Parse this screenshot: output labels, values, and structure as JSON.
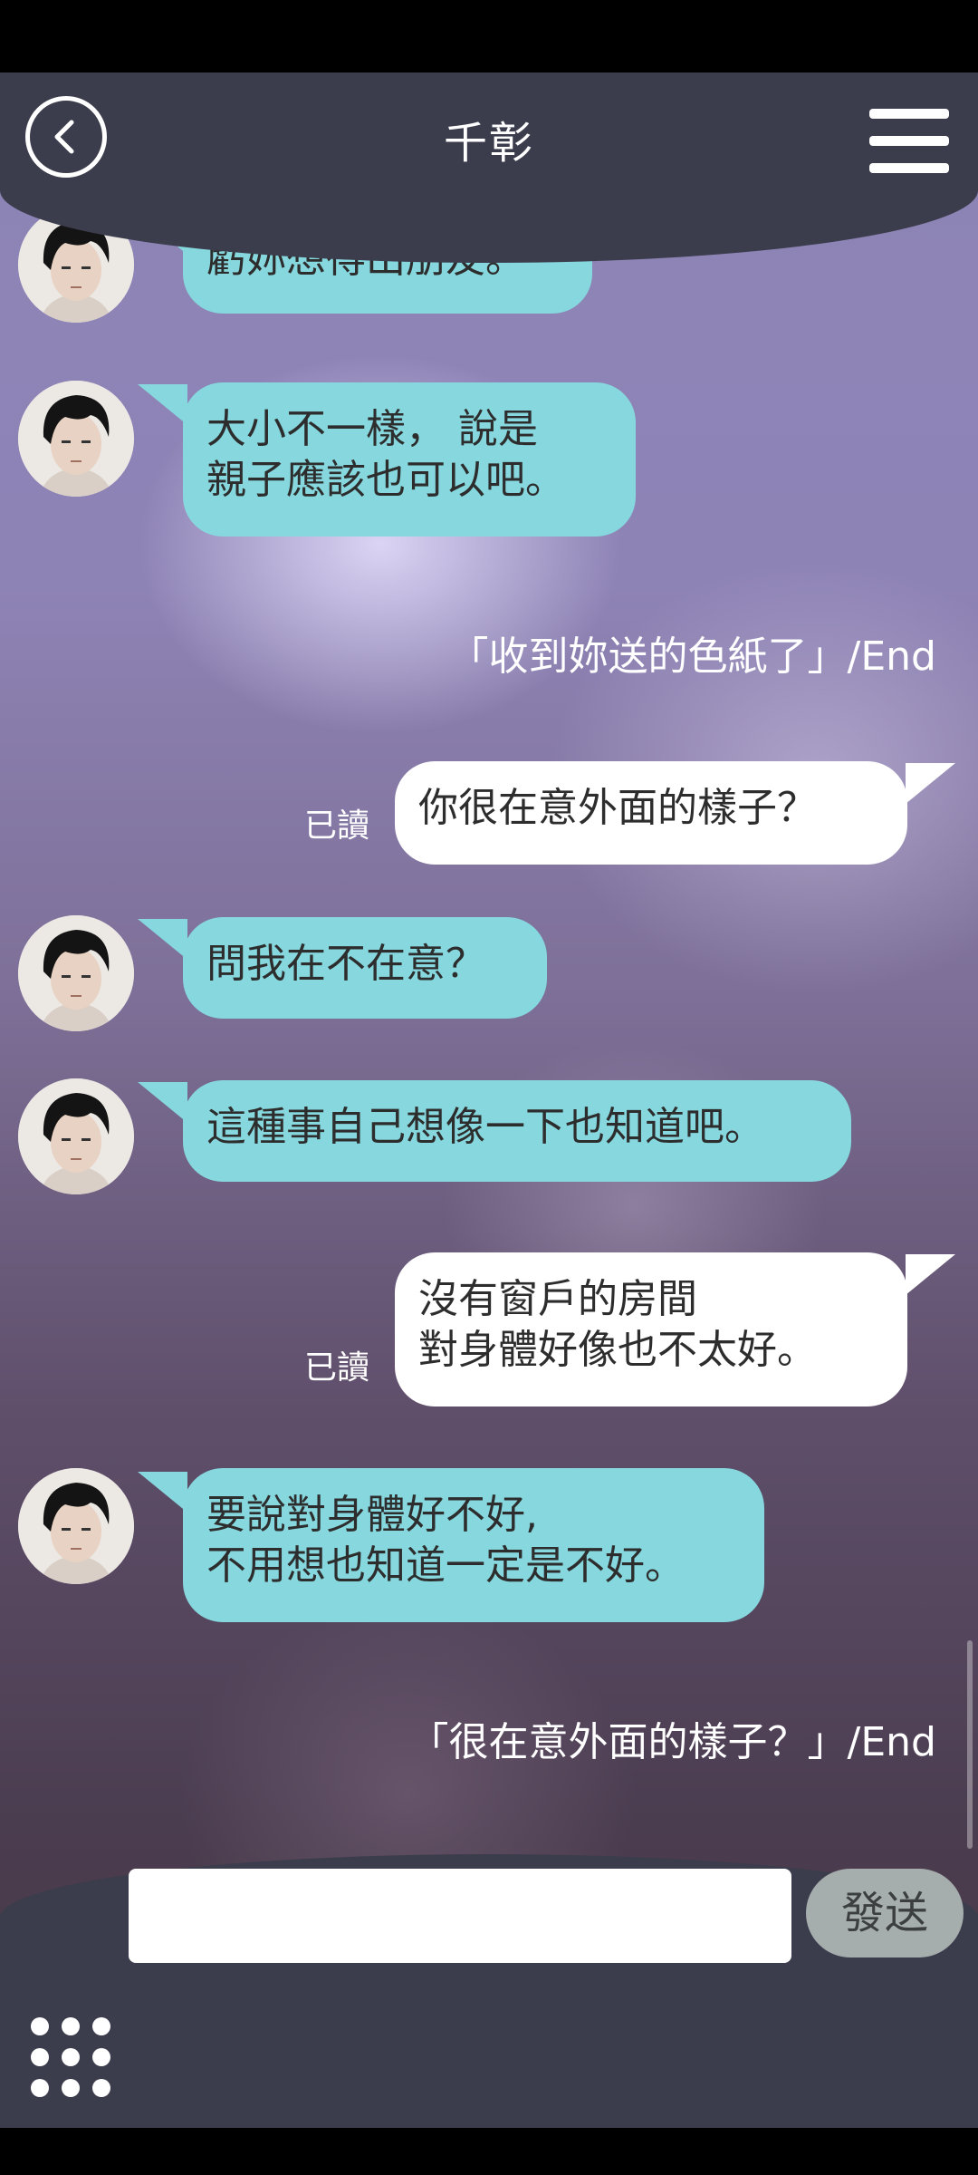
{
  "header": {
    "title": "千彰"
  },
  "messages": {
    "m1": {
      "lines": [
        "虧妳想得出朋友。"
      ]
    },
    "m2": {
      "lines": [
        "大小不一樣， 說是",
        "親子應該也可以吧。"
      ]
    },
    "sys1": "「收到妳送的色紙了」/End",
    "m3": {
      "read": "已讀",
      "lines": [
        "你很在意外面的樣子？"
      ]
    },
    "m4": {
      "lines": [
        "問我在不在意？"
      ]
    },
    "m5": {
      "lines": [
        "這種事自己想像一下也知道吧。"
      ]
    },
    "m6": {
      "read": "已讀",
      "lines": [
        "沒有窗戶的房間",
        "對身體好像也不太好。"
      ]
    },
    "m7": {
      "lines": [
        "要說對身體好不好,",
        "不用想也知道一定是不好。"
      ]
    },
    "sys2": "「很在意外面的樣子？」/End"
  },
  "composer": {
    "input_value": "",
    "send_label": "發送"
  },
  "icons": {
    "back": "back-arrow-circle-icon",
    "menu": "hamburger-menu-icon",
    "apps": "grid-dots-icon",
    "avatar": "character-avatar"
  },
  "colors": {
    "header": "#3b3d4c",
    "bubble_left": "#86d7de",
    "bubble_right": "#ffffff",
    "send_button": "#a6adad"
  }
}
